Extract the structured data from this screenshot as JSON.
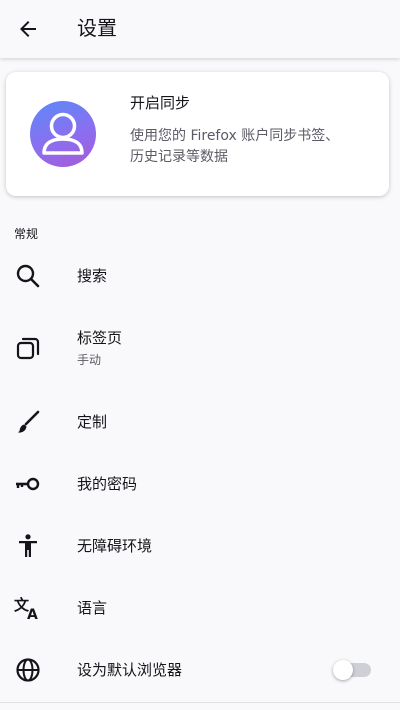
{
  "toolbar": {
    "title": "设置",
    "back_icon": "arrow-back-icon"
  },
  "sync_card": {
    "title": "开启同步",
    "description": "使用您的 Firefox 账户同步书签、历史记录等数据",
    "avatar_icon": "account-avatar-icon"
  },
  "section": {
    "header": "常规"
  },
  "items": [
    {
      "label": "搜索",
      "icon": "search-icon"
    },
    {
      "label": "标签页",
      "sublabel": "手动",
      "icon": "tabs-icon"
    },
    {
      "label": "定制",
      "icon": "brush-icon"
    },
    {
      "label": "我的密码",
      "icon": "key-icon"
    },
    {
      "label": "无障碍环境",
      "icon": "accessibility-icon"
    },
    {
      "label": "语言",
      "icon": "translate-icon"
    },
    {
      "label": "设为默认浏览器",
      "icon": "globe-icon",
      "toggle": false
    }
  ],
  "colors": {
    "background": "#f9f9fb",
    "text_primary": "#15141a",
    "text_secondary": "#5b5b66",
    "avatar_gradient_start": "#5b8af7",
    "avatar_gradient_end": "#a65ad6",
    "toggle_track_off": "#cfcfd8"
  }
}
